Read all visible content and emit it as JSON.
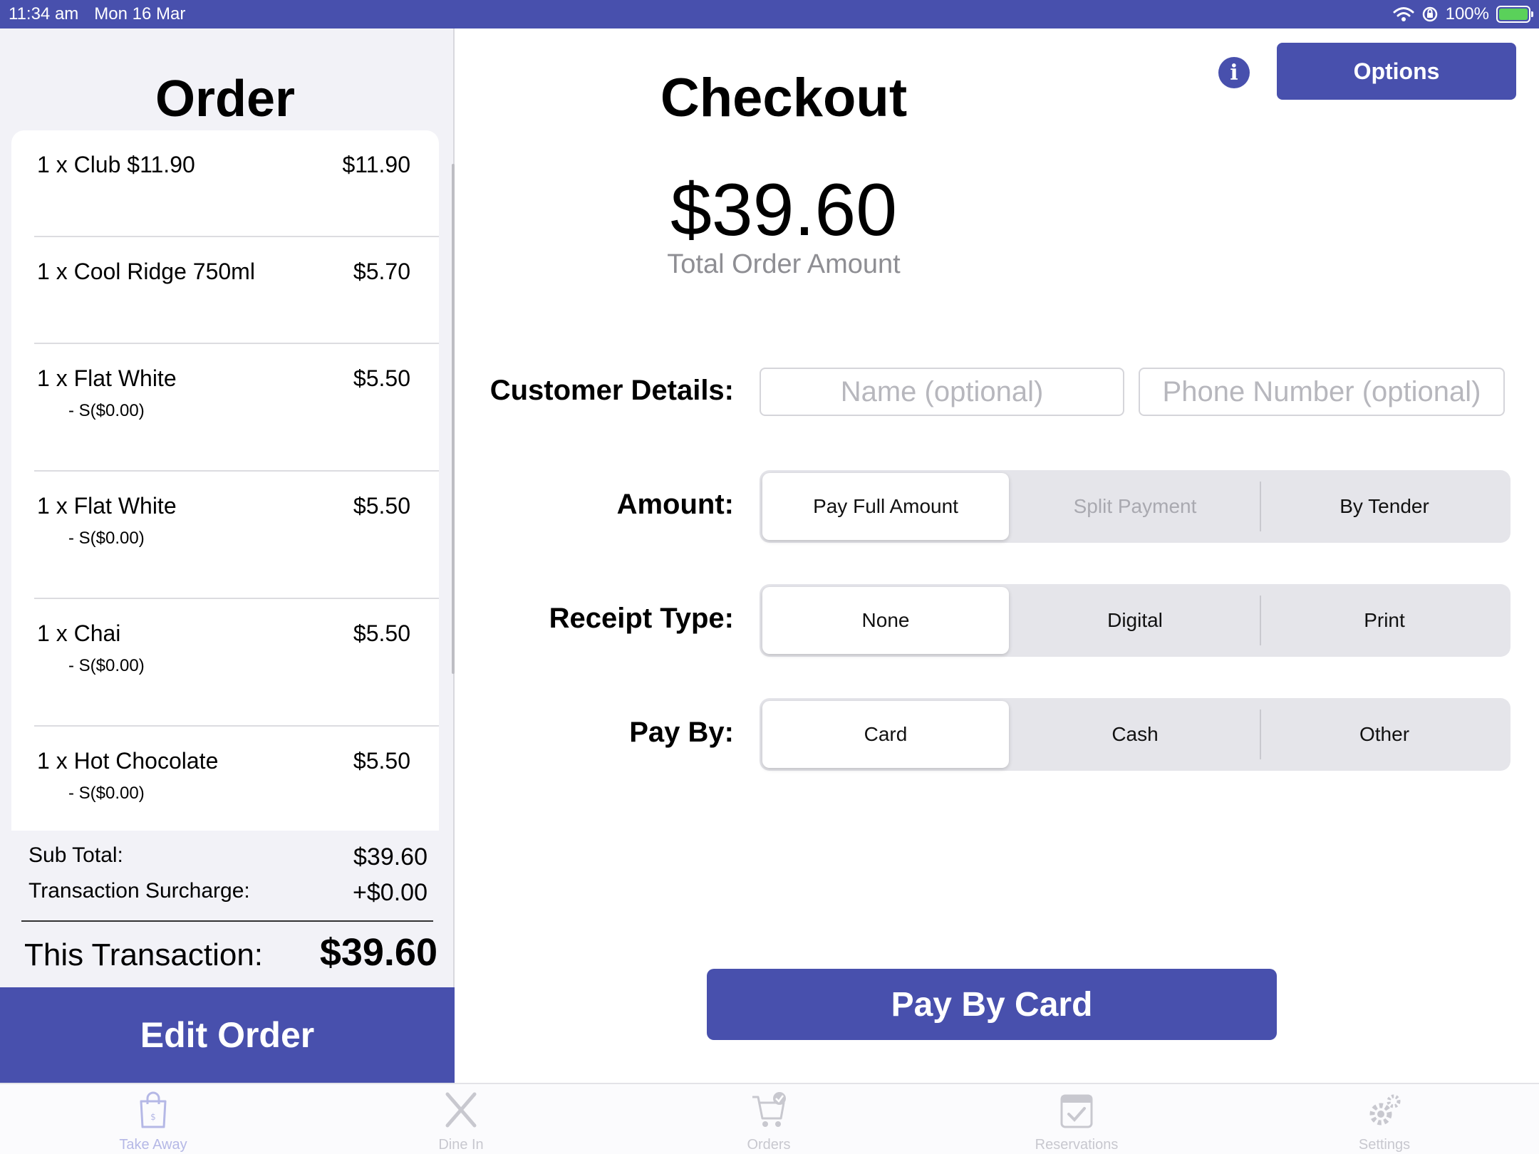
{
  "status_bar": {
    "time": "11:34 am",
    "date": "Mon 16 Mar",
    "battery": "100%"
  },
  "order": {
    "title": "Order",
    "items": [
      {
        "name": "1 x Club $11.90",
        "price": "$11.90",
        "modifier": ""
      },
      {
        "name": "1 x Cool Ridge 750ml",
        "price": "$5.70",
        "modifier": ""
      },
      {
        "name": "1 x Flat White",
        "price": "$5.50",
        "modifier": "- S($0.00)"
      },
      {
        "name": "1 x Flat White",
        "price": "$5.50",
        "modifier": "- S($0.00)"
      },
      {
        "name": "1 x Chai",
        "price": "$5.50",
        "modifier": "- S($0.00)"
      },
      {
        "name": "1 x Hot Chocolate",
        "price": "$5.50",
        "modifier": "- S($0.00)"
      }
    ],
    "sub_total_label": "Sub Total:",
    "sub_total_value": "$39.60",
    "surcharge_label": "Transaction Surcharge:",
    "surcharge_value": "+$0.00",
    "transaction_label": "This Transaction:",
    "transaction_value": "$39.60",
    "edit_button": "Edit Order"
  },
  "checkout": {
    "title": "Checkout",
    "options_button": "Options",
    "info_glyph": "i",
    "total_amount": "$39.60",
    "total_label": "Total Order Amount",
    "customer_label": "Customer Details:",
    "name_placeholder": "Name (optional)",
    "phone_placeholder": "Phone Number (optional)",
    "amount_label": "Amount:",
    "amount_options": [
      "Pay Full Amount",
      "Split Payment",
      "By Tender"
    ],
    "receipt_label": "Receipt Type:",
    "receipt_options": [
      "None",
      "Digital",
      "Print"
    ],
    "payby_label": "Pay By:",
    "payby_options": [
      "Card",
      "Cash",
      "Other"
    ],
    "pay_button": "Pay By Card"
  },
  "tabs": [
    {
      "label": "Take Away",
      "icon": "shopping-bag-icon"
    },
    {
      "label": "Dine In",
      "icon": "cutlery-icon"
    },
    {
      "label": "Orders",
      "icon": "cart-check-icon"
    },
    {
      "label": "Reservations",
      "icon": "calendar-check-icon"
    },
    {
      "label": "Settings",
      "icon": "gears-icon"
    }
  ],
  "colors": {
    "accent": "#4850ad",
    "tab_active": "#b5b8e6",
    "tab_inactive": "#c8c8cf"
  }
}
